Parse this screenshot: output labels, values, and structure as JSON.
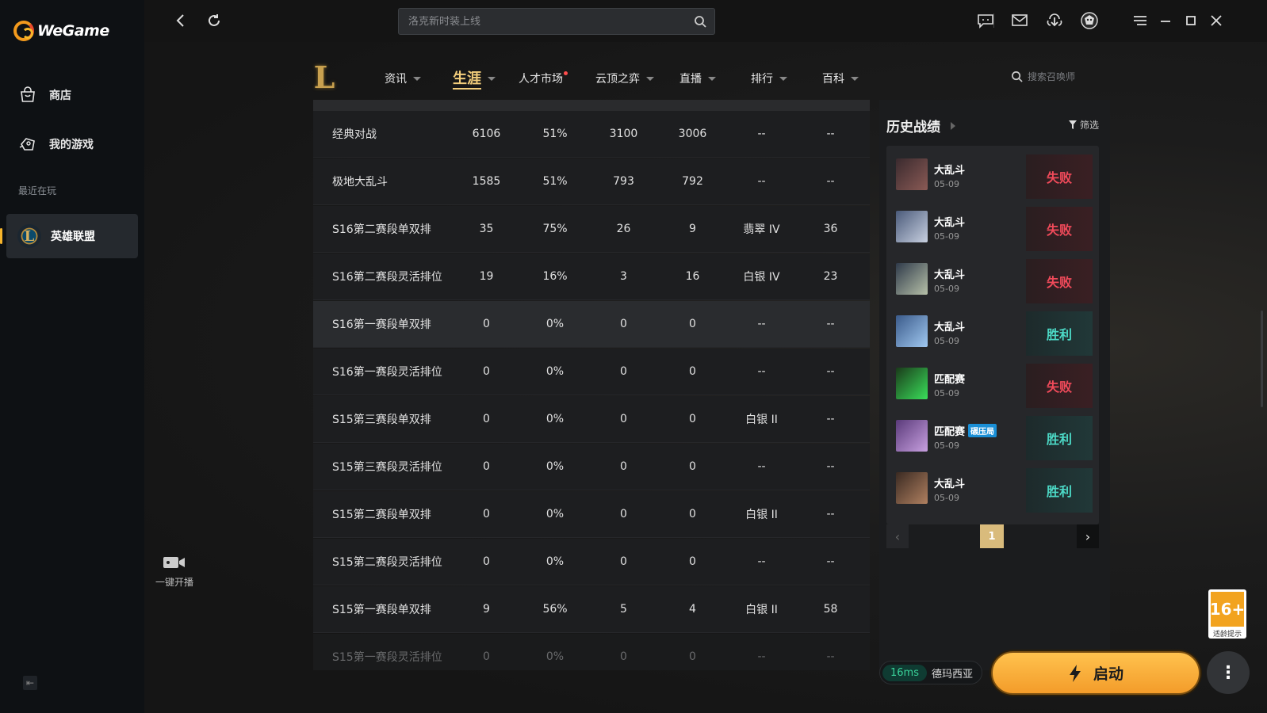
{
  "app": {
    "brand": "WeGame"
  },
  "sidebar": {
    "items": [
      {
        "label": "商店",
        "icon": "bag-icon"
      },
      {
        "label": "我的游戏",
        "icon": "game-controller-icon"
      }
    ],
    "recent_title": "最近在玩",
    "recent_game": "英雄联盟"
  },
  "topbar": {
    "search_placeholder": "洛克新时装上线"
  },
  "live": {
    "label": "一键开播"
  },
  "tabs": [
    {
      "label": "资讯",
      "caret": true
    },
    {
      "label": "生涯",
      "caret": true,
      "active": true
    },
    {
      "label": "人才市场",
      "caret": false,
      "dot": true
    },
    {
      "label": "云顶之弈",
      "caret": true
    },
    {
      "label": "直播",
      "caret": true
    },
    {
      "label": "排行",
      "caret": true
    },
    {
      "label": "百科",
      "caret": true
    }
  ],
  "summoner_search_placeholder": "搜索召唤师",
  "stats": {
    "rows": [
      {
        "name": "经典对战",
        "games": "6106",
        "winrate": "51%",
        "wins": "3100",
        "losses": "3006",
        "rank": "--",
        "points": "--"
      },
      {
        "name": "极地大乱斗",
        "games": "1585",
        "winrate": "51%",
        "wins": "793",
        "losses": "792",
        "rank": "--",
        "points": "--"
      },
      {
        "name": "S16第二赛段单双排",
        "games": "35",
        "winrate": "75%",
        "wins": "26",
        "losses": "9",
        "rank": "翡翠 IV",
        "points": "36"
      },
      {
        "name": "S16第二赛段灵活排位",
        "games": "19",
        "winrate": "16%",
        "wins": "3",
        "losses": "16",
        "rank": "白银 IV",
        "points": "23"
      },
      {
        "name": "S16第一赛段单双排",
        "games": "0",
        "winrate": "0%",
        "wins": "0",
        "losses": "0",
        "rank": "--",
        "points": "--"
      },
      {
        "name": "S16第一赛段灵活排位",
        "games": "0",
        "winrate": "0%",
        "wins": "0",
        "losses": "0",
        "rank": "--",
        "points": "--"
      },
      {
        "name": "S15第三赛段单双排",
        "games": "0",
        "winrate": "0%",
        "wins": "0",
        "losses": "0",
        "rank": "白银 II",
        "points": "--"
      },
      {
        "name": "S15第三赛段灵活排位",
        "games": "0",
        "winrate": "0%",
        "wins": "0",
        "losses": "0",
        "rank": "--",
        "points": "--"
      },
      {
        "name": "S15第二赛段单双排",
        "games": "0",
        "winrate": "0%",
        "wins": "0",
        "losses": "0",
        "rank": "白银 II",
        "points": "--"
      },
      {
        "name": "S15第二赛段灵活排位",
        "games": "0",
        "winrate": "0%",
        "wins": "0",
        "losses": "0",
        "rank": "--",
        "points": "--"
      },
      {
        "name": "S15第一赛段单双排",
        "games": "9",
        "winrate": "56%",
        "wins": "5",
        "losses": "4",
        "rank": "白银 II",
        "points": "58"
      },
      {
        "name": "S15第一赛段灵活排位",
        "games": "0",
        "winrate": "0%",
        "wins": "0",
        "losses": "0",
        "rank": "--",
        "points": "--"
      }
    ]
  },
  "history": {
    "title": "历史战绩",
    "filter_label": "筛选",
    "matches": [
      {
        "mode": "大乱斗",
        "date": "05-09",
        "result": "失败",
        "outcome": "lose",
        "tag": ""
      },
      {
        "mode": "大乱斗",
        "date": "05-09",
        "result": "失败",
        "outcome": "lose",
        "tag": ""
      },
      {
        "mode": "大乱斗",
        "date": "05-09",
        "result": "失败",
        "outcome": "lose",
        "tag": ""
      },
      {
        "mode": "大乱斗",
        "date": "05-09",
        "result": "胜利",
        "outcome": "win",
        "tag": ""
      },
      {
        "mode": "匹配赛",
        "date": "05-09",
        "result": "失败",
        "outcome": "lose",
        "tag": ""
      },
      {
        "mode": "匹配赛",
        "date": "05-09",
        "result": "胜利",
        "outcome": "win",
        "tag": "碾压局"
      },
      {
        "mode": "大乱斗",
        "date": "05-09",
        "result": "胜利",
        "outcome": "win",
        "tag": ""
      }
    ],
    "page": "1"
  },
  "age_rating": {
    "age": "16+",
    "label": "适龄提示"
  },
  "launch": {
    "ping": "16ms",
    "server": "德玛西亚",
    "button_label": "启动"
  },
  "colors": {
    "accent_gold": "#f2cd7b",
    "lose": "#f04a5a",
    "win": "#4cd9c6",
    "launch": "#f7ad35"
  }
}
